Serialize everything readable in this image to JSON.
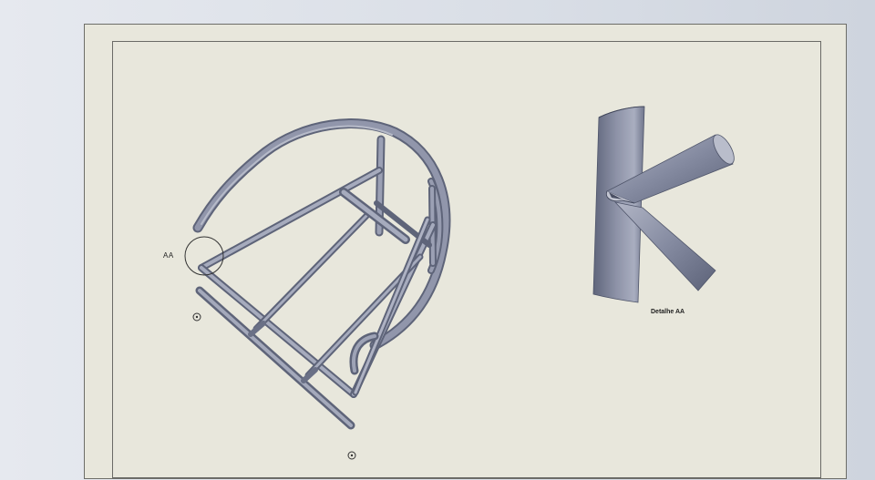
{
  "drawing": {
    "detail_circle_label": "AA",
    "detail_view_caption": "Detalhe AA"
  },
  "colors": {
    "background": "#dde1e8",
    "sheet": "#e8e7dc",
    "tube_fill": "#8a90a6",
    "tube_dark": "#5c6278",
    "tube_light": "#b9bdcb",
    "line": "#3a3a3a"
  },
  "icons": [
    "center-mark-icon",
    "center-mark-icon"
  ]
}
